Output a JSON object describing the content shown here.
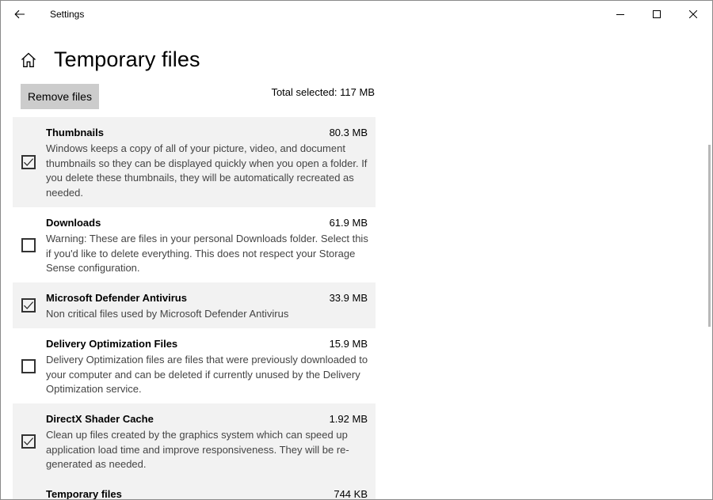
{
  "window": {
    "title": "Settings"
  },
  "header": {
    "title": "Temporary files"
  },
  "toolbar": {
    "remove_label": "Remove files",
    "total_selected": "Total selected: 117 MB"
  },
  "items": [
    {
      "name": "Thumbnails",
      "size": "80.3 MB",
      "checked": true,
      "description": "Windows keeps a copy of all of your picture, video, and document thumbnails so they can be displayed quickly when you open a folder. If you delete these thumbnails, they will be automatically recreated as needed."
    },
    {
      "name": "Downloads",
      "size": "61.9 MB",
      "checked": false,
      "description": "Warning: These are files in your personal Downloads folder. Select this if you'd like to delete everything. This does not respect your Storage Sense configuration."
    },
    {
      "name": "Microsoft Defender Antivirus",
      "size": "33.9 MB",
      "checked": true,
      "description": "Non critical files used by Microsoft Defender Antivirus"
    },
    {
      "name": "Delivery Optimization Files",
      "size": "15.9 MB",
      "checked": false,
      "description": "Delivery Optimization files are files that were previously downloaded to your computer and can be deleted if currently unused by the Delivery Optimization service."
    },
    {
      "name": "DirectX Shader Cache",
      "size": "1.92 MB",
      "checked": true,
      "description": "Clean up files created by the graphics system which can speed up application load time and improve responsiveness. They will be re-generated as needed."
    },
    {
      "name": "Temporary files",
      "size": "744 KB",
      "checked": true,
      "description": ""
    }
  ],
  "icons": {
    "back": "back-arrow-icon",
    "home": "home-icon",
    "minimize": "minimize-icon",
    "maximize": "maximize-icon",
    "close": "close-icon",
    "check": "check-icon"
  },
  "colors": {
    "button_bg": "#cccccc",
    "checked_row_bg": "#f2f2f2",
    "description_text": "#444444"
  }
}
